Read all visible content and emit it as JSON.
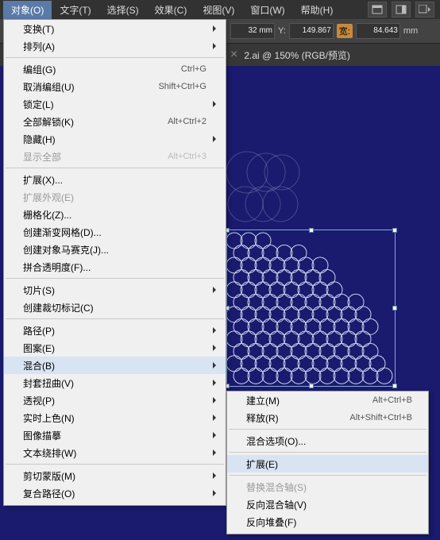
{
  "menubar": {
    "items": [
      "对象(O)",
      "文字(T)",
      "选择(S)",
      "效果(C)",
      "视图(V)",
      "窗口(W)",
      "帮助(H)"
    ]
  },
  "toolbar": {
    "xunit": "32 mm",
    "ylabel": "Y:",
    "y": "149.867",
    "wlabel": "宽:",
    "w": "84.643",
    "unit": "mm"
  },
  "tabbar": {
    "sep": "×",
    "tab": "2.ai @ 150% (RGB/预览)"
  },
  "menu": {
    "groups": [
      {
        "items": [
          {
            "label": "变换(T)",
            "sub": true
          },
          {
            "label": "排列(A)",
            "sub": true
          }
        ]
      },
      {
        "items": [
          {
            "label": "编组(G)",
            "shortcut": "Ctrl+G"
          },
          {
            "label": "取消编组(U)",
            "shortcut": "Shift+Ctrl+G"
          },
          {
            "label": "锁定(L)",
            "sub": true
          },
          {
            "label": "全部解锁(K)",
            "shortcut": "Alt+Ctrl+2"
          },
          {
            "label": "隐藏(H)",
            "sub": true
          },
          {
            "label": "显示全部",
            "shortcut": "Alt+Ctrl+3",
            "disabled": true
          }
        ]
      },
      {
        "items": [
          {
            "label": "扩展(X)..."
          },
          {
            "label": "扩展外观(E)",
            "disabled": true
          },
          {
            "label": "栅格化(Z)..."
          },
          {
            "label": "创建渐变网格(D)..."
          },
          {
            "label": "创建对象马赛克(J)..."
          },
          {
            "label": "拼合透明度(F)..."
          }
        ]
      },
      {
        "items": [
          {
            "label": "切片(S)",
            "sub": true
          },
          {
            "label": "创建裁切标记(C)"
          }
        ]
      },
      {
        "items": [
          {
            "label": "路径(P)",
            "sub": true
          },
          {
            "label": "图案(E)",
            "sub": true
          },
          {
            "label": "混合(B)",
            "sub": true,
            "highlight": true
          },
          {
            "label": "封套扭曲(V)",
            "sub": true
          },
          {
            "label": "透视(P)",
            "sub": true
          },
          {
            "label": "实时上色(N)",
            "sub": true
          },
          {
            "label": "图像描摹",
            "sub": true
          },
          {
            "label": "文本绕排(W)",
            "sub": true
          }
        ]
      },
      {
        "items": [
          {
            "label": "剪切蒙版(M)",
            "sub": true
          },
          {
            "label": "复合路径(O)",
            "sub": true
          }
        ]
      }
    ]
  },
  "submenu": {
    "groups": [
      {
        "items": [
          {
            "label": "建立(M)",
            "shortcut": "Alt+Ctrl+B"
          },
          {
            "label": "释放(R)",
            "shortcut": "Alt+Shift+Ctrl+B"
          }
        ]
      },
      {
        "items": [
          {
            "label": "混合选项(O)..."
          }
        ]
      },
      {
        "items": [
          {
            "label": "扩展(E)",
            "highlight": true
          }
        ]
      },
      {
        "items": [
          {
            "label": "替换混合轴(S)",
            "disabled": true
          },
          {
            "label": "反向混合轴(V)"
          },
          {
            "label": "反向堆叠(F)"
          }
        ]
      }
    ]
  }
}
